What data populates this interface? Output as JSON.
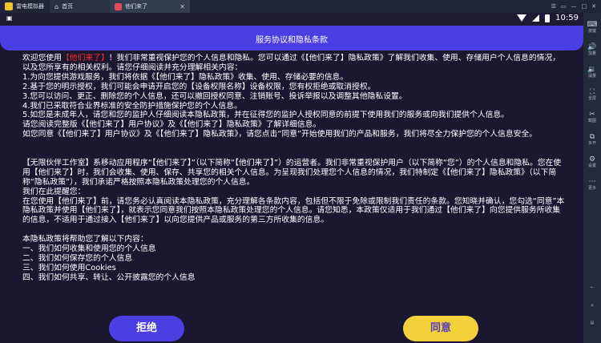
{
  "emulator": {
    "tabs": [
      {
        "label": "雷电模拟器"
      },
      {
        "label": "首页"
      },
      {
        "label": "他们来了"
      }
    ],
    "controls": [
      "☰",
      "▭",
      "—",
      "□",
      "✕"
    ],
    "sidebar": [
      {
        "icon": "keyboard-icon",
        "glyph": "⌨",
        "label": "按键"
      },
      {
        "icon": "volume-up-icon",
        "glyph": "🔊",
        "label": "加量"
      },
      {
        "icon": "volume-down-icon",
        "glyph": "🔉",
        "label": "减量"
      },
      {
        "icon": "fullscreen-icon",
        "glyph": "⛶",
        "label": "全屏"
      },
      {
        "icon": "screenshot-icon",
        "glyph": "✂",
        "label": "截图"
      },
      {
        "icon": "multi-open-icon",
        "glyph": "⧉",
        "label": "多开"
      },
      {
        "icon": "settings-icon",
        "glyph": "⚙",
        "label": "设置"
      },
      {
        "icon": "more-icon",
        "glyph": "⋯",
        "label": "更多"
      },
      {
        "icon": "back-icon",
        "glyph": "←",
        "label": ""
      },
      {
        "icon": "home-icon",
        "glyph": "⌂",
        "label": ""
      },
      {
        "icon": "recent-apps-icon",
        "glyph": "▤",
        "label": ""
      }
    ]
  },
  "status_bar": {
    "left_icon": "app-status-icon",
    "time": "10:59"
  },
  "dialog": {
    "title": "服务协议和隐私条款",
    "app_name": "【他们来了】",
    "intro_prefix": "欢迎您使用",
    "intro_suffix": "！我们非常重视保护您的个人信息和隐私。您可以通过《【他们来了】隐私政策》了解我们收集、使用、存储用户个人信息的情况，以及您所享有的相关权利。请您仔细阅读并充分理解相关内容：",
    "items": [
      "1.为向您提供游戏服务，我们将依据《【他们来了】隐私政策》收集、使用、存储必要的信息。",
      "2.基于您的明示授权，我们可能会申请开启您的【设备权限名称】设备权限，您有权拒绝或取消授权。",
      "3.您可以访问、更正、删除您的个人信息，还可以撤回授权同意、注销账号、投诉举报以及调整其他隐私设置。",
      "4.我们已采取符合业界标准的安全防护措施保护您的个人信息。",
      "5.如您是未成年人，请您和您的监护人仔细阅读本隐私政策，并在征得您的监护人授权同意的前提下使用我们的服务或向我们提供个人信息。"
    ],
    "read_line": "请您阅读完整版《【他们来了】用户协议》及《【他们来了】隐私政策》了解详细信息。",
    "agree_line": "如您同意《【他们来了】用户协议》及《【他们来了】隐私政策》，请您点击“同意”开始使用我们的产品和服务，我们将尽全力保护您的个人信息安全。",
    "company_para": "【无限伙伴工作室】系移动应用程序“【他们来了】”（以下简称“【他们来了】”）的运营者。我们非常重视保护用户（以下简称“您”）的个人信息和隐私。您在使用【他们来了】时，我们会收集、使用、保存、共享您的相关个人信息。为呈现我们处理您个人信息的情况，我们特制定《【他们来了】隐私政策》（以下简称“隐私政策”），我们承诺严格按照本隐私政策处理您的个人信息。",
    "reminder_title": "我们在此提醒您：",
    "reminder_text": "在您使用【他们来了】前，请您务必认真阅读本隐私政策，充分理解各条款内容，包括但不限于免除或限制我们责任的条款。您知晓并确认，您勾选“同意”本隐私政策并使用【他们来了】，就表示您同意我们按照本隐私政策处理您的个人信息。请您知悉，本政策仅适用于我们通过【他们来了】向您提供服务所收集的信息，不适用于通过接入【他们来了】以向您提供产品或服务的第三方所收集的信息。",
    "help_title": "本隐私政策将帮助您了解以下内容：",
    "toc": [
      "一、我们如何收集和使用您的个人信息",
      "二、我们如何保存您的个人信息",
      "三、我们如何使用Cookies",
      "四、我们如何共享、转让、公开披露您的个人信息"
    ],
    "reject_label": "拒绝",
    "agree_label": "同意"
  }
}
